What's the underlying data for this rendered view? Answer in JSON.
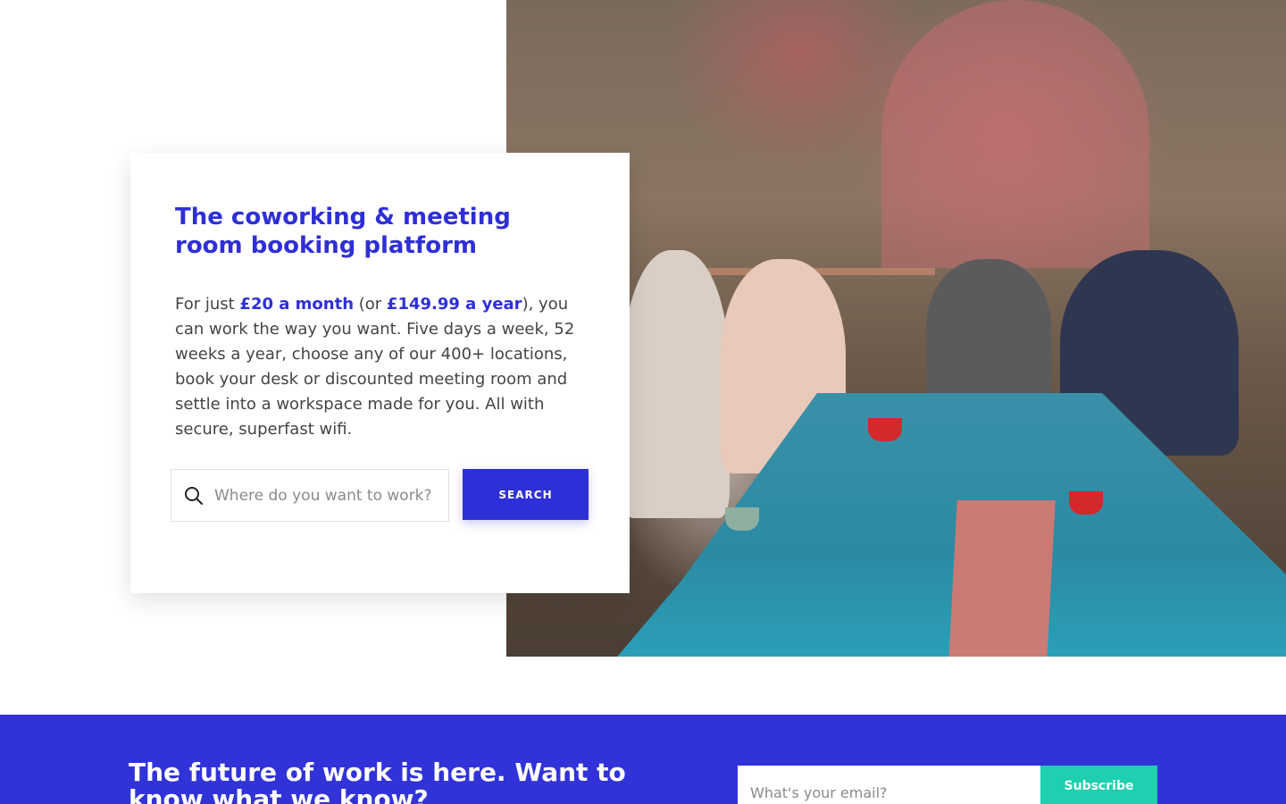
{
  "hero": {
    "image_alt": "People meeting around a tiled table",
    "title": "The coworking & meeting room booking platform",
    "text": {
      "prefix": "For just ",
      "monthly_price": "£20 a month",
      "middle": " (or ",
      "yearly_price": "£149.99 a year",
      "suffix": "), you can work the way you want. Five days a week, 52 weeks a year, choose any of our 400+ locations, book your desk or discounted meeting room and settle into a workspace made for you. All with secure, superfast wifi."
    },
    "search": {
      "placeholder": "Where do you want to work?",
      "button_label": "SEARCH",
      "icon": "search-icon"
    }
  },
  "newsletter": {
    "title": "The future of work is here. Want to know what we know?",
    "email_placeholder": "What's your email?",
    "subscribe_label": "Subscribe"
  },
  "colors": {
    "brand_blue": "#2e2fd6",
    "banner_blue": "#3133d8",
    "teal": "#1ecfb0"
  }
}
